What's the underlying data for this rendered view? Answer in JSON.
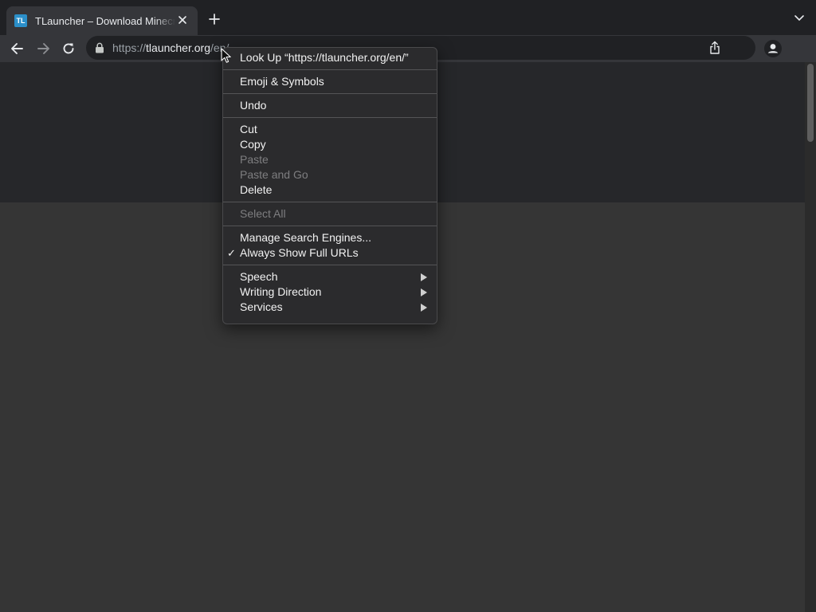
{
  "tab": {
    "favicon_text": "TL",
    "title": "TLauncher – Download Minecraft"
  },
  "toolbar": {
    "url_scheme": "https://",
    "url_host": "tlauncher.org",
    "url_path": "/en/"
  },
  "context_menu": {
    "items": [
      {
        "label": "Look Up “https://tlauncher.org/en/”",
        "enabled": true
      },
      {
        "label": "Emoji & Symbols",
        "enabled": true
      },
      {
        "label": "Undo",
        "enabled": true
      },
      {
        "label": "Cut",
        "enabled": true
      },
      {
        "label": "Copy",
        "enabled": true
      },
      {
        "label": "Paste",
        "enabled": false
      },
      {
        "label": "Paste and Go",
        "enabled": false
      },
      {
        "label": "Delete",
        "enabled": true
      },
      {
        "label": "Select All",
        "enabled": false
      },
      {
        "label": "Manage Search Engines...",
        "enabled": true
      },
      {
        "label": "Always Show Full URLs",
        "enabled": true,
        "checked": true,
        "check_glyph": "✓"
      },
      {
        "label": "Speech",
        "enabled": true,
        "submenu": true
      },
      {
        "label": "Writing Direction",
        "enabled": true,
        "submenu": true
      },
      {
        "label": "Services",
        "enabled": true,
        "submenu": true
      }
    ]
  },
  "colors": {
    "tabstrip_bg": "#202124",
    "toolbar_bg": "#35363a",
    "page_header_bg": "#26272a",
    "page_body_bg": "#353535",
    "menu_bg": "#2b2b2d",
    "favicon_bg": "#2b8fc9"
  },
  "icons": {
    "tab_close": "close-icon",
    "new_tab": "plus-icon",
    "tab_search": "chevron-down-icon",
    "back": "arrow-left-icon",
    "forward": "arrow-right-icon",
    "reload": "reload-icon",
    "lock": "lock-icon",
    "share": "share-icon",
    "profile": "profile-icon",
    "cursor": "mouse-pointer-icon"
  }
}
